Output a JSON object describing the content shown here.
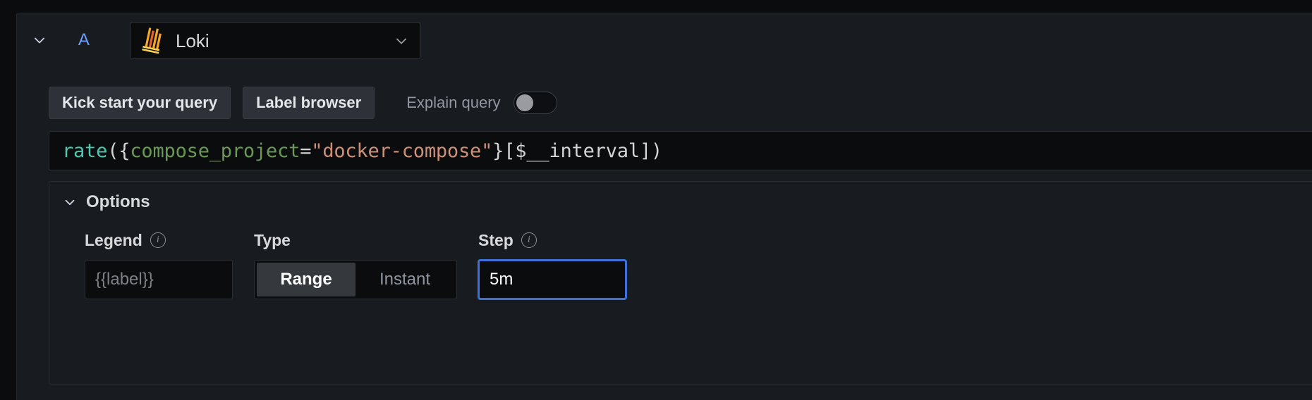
{
  "query_row": {
    "collapse_icon": "chevron-down-icon",
    "ref_id": "A",
    "datasource": {
      "name": "Loki",
      "logo_icon": "loki-logo-icon",
      "caret_icon": "chevron-down-icon"
    }
  },
  "toolbar": {
    "kick_start_label": "Kick start your query",
    "label_browser_label": "Label browser",
    "explain_query_label": "Explain query",
    "explain_query_enabled": false
  },
  "query": {
    "expression": "rate({compose_project=\"docker-compose\"}[$__interval])",
    "tokens": [
      {
        "text": "rate",
        "kind": "fn"
      },
      {
        "text": "({",
        "kind": "punct"
      },
      {
        "text": "compose_project",
        "kind": "label"
      },
      {
        "text": "=",
        "kind": "op"
      },
      {
        "text": "\"docker-compose\"",
        "kind": "string"
      },
      {
        "text": "}[$__interval])",
        "kind": "var"
      }
    ]
  },
  "options": {
    "title": "Options",
    "collapse_icon": "chevron-down-icon",
    "legend": {
      "label": "Legend",
      "info_icon": "info-circle-icon",
      "value": "",
      "placeholder": "{{label}}"
    },
    "type": {
      "label": "Type",
      "options": [
        "Range",
        "Instant"
      ],
      "selected": "Range"
    },
    "step": {
      "label": "Step",
      "info_icon": "info-circle-icon",
      "value": "5m",
      "placeholder": "",
      "focused": true
    }
  },
  "colors": {
    "page_bg": "#0b0c0e",
    "panel_bg": "#181b1f",
    "input_bg": "#0b0c0e",
    "accent_blue": "#3d71d9",
    "refid_blue": "#6e9fff",
    "text_primary": "#d8d9da",
    "text_secondary": "#9095a0",
    "syntax_fn": "#4ec9b0",
    "syntax_label": "#6a9955",
    "syntax_string": "#ce9178",
    "loki_orange": "#f5a623",
    "loki_red": "#e8642b"
  }
}
